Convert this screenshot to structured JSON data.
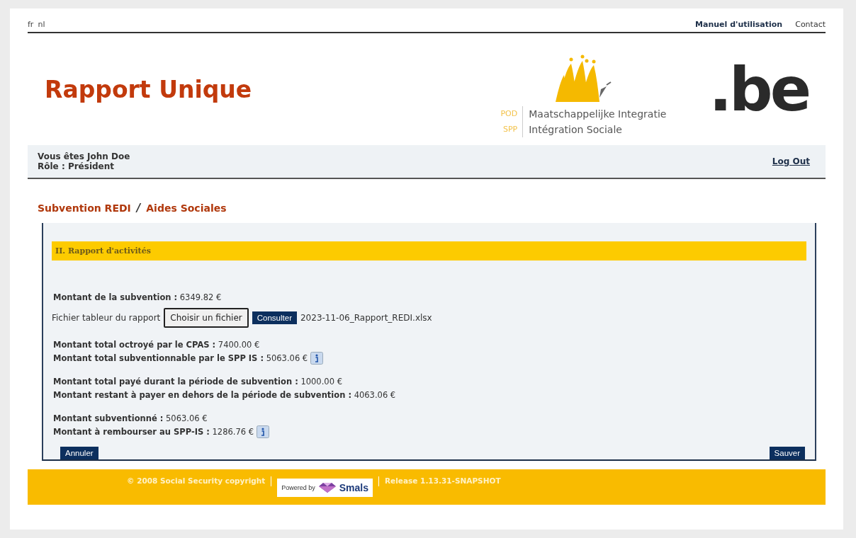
{
  "top_bar": {
    "languages": [
      "fr",
      "nl"
    ],
    "links": [
      {
        "label": "Manuel d'utilisation",
        "bold": true
      },
      {
        "label": "Contact",
        "bold": false
      }
    ]
  },
  "header": {
    "title": "Rapport Unique",
    "org": {
      "codes": [
        "POD",
        "SPP"
      ],
      "names": [
        "Maatschappelijke Integratie",
        "Intégration Sociale"
      ]
    },
    "be_logo": ".be"
  },
  "user_bar": {
    "lines": [
      "Vous êtes John Doe",
      "Rôle : Président"
    ],
    "logout": "Log Out"
  },
  "breadcrumb": {
    "items": [
      "Subvention REDI",
      "Aides Sociales"
    ],
    "separator": "/"
  },
  "section": {
    "title": "II. Rapport d'activités",
    "first_group": [
      {
        "label": "Montant de la subvention :",
        "value": "6349.82 €",
        "info": false
      }
    ],
    "file_row": {
      "label": "Fichier tableur du rapport",
      "choose_button": "Choisir un fichier",
      "view_button": "Consulter",
      "file_name": "2023-11-06_Rapport_REDI.xlsx"
    },
    "groups": [
      [
        {
          "label": "Montant total octroyé par le CPAS :",
          "value": "7400.00 €",
          "info": false
        },
        {
          "label": "Montant total subventionnable par le SPP IS :",
          "value": "5063.06 €",
          "info": true
        }
      ],
      [
        {
          "label": "Montant total payé durant la période de subvention :",
          "value": "1000.00 €",
          "info": false
        },
        {
          "label": "Montant restant à payer en dehors de la période de subvention :",
          "value": "4063.06 €",
          "info": false
        }
      ],
      [
        {
          "label": "Montant subventionné :",
          "value": "5063.06 €",
          "info": false
        },
        {
          "label": "Montant à rembourser au SPP-IS :",
          "value": "1286.76 €",
          "info": true
        }
      ]
    ],
    "buttons": {
      "cancel": "Annuler",
      "save": "Sauver"
    }
  },
  "footer": {
    "copyright": "© 2008 Social Security copyright",
    "powered": {
      "prefix": "Powered by",
      "brand": "Smals"
    },
    "release": "Release 1.13.31-SNAPSHOT"
  }
}
